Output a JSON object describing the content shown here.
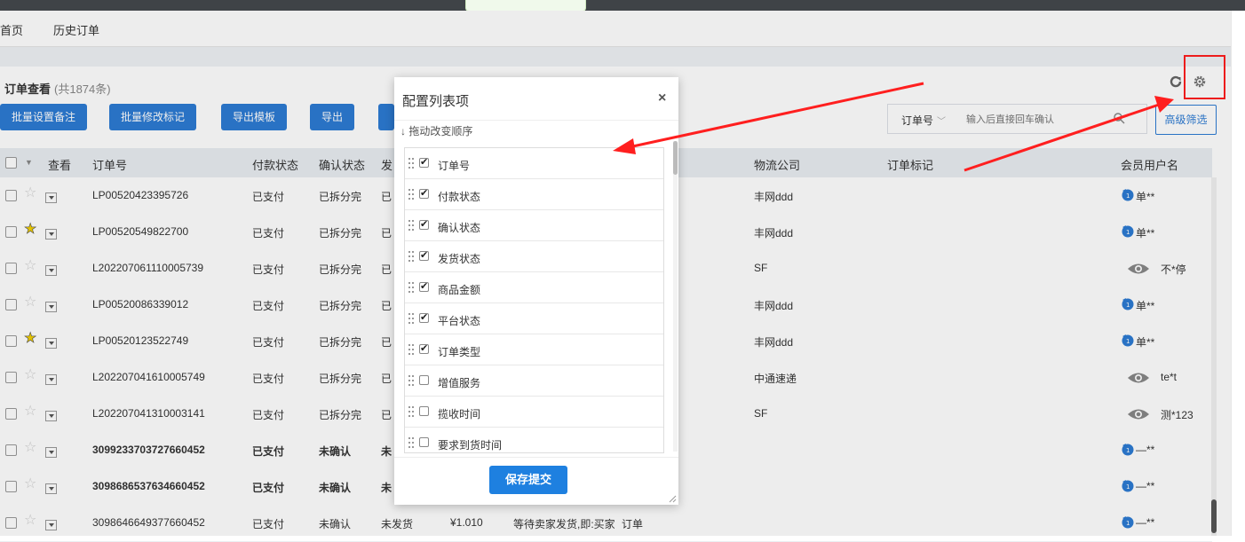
{
  "nav": {
    "tab_home": "首页",
    "tab_history": "历史订单"
  },
  "page": {
    "title": "订单查看",
    "count": "(共1874条)"
  },
  "toolbar": {
    "btn_batch_remark": "批量设置备注",
    "btn_batch_mark": "批量修改标记",
    "btn_export_template": "导出模板",
    "btn_export": "导出"
  },
  "search": {
    "field_select": "订单号",
    "placeholder": "输入后直接回车确认"
  },
  "advanced_filter": "高级筛选",
  "icons": {
    "refresh": "refresh-icon",
    "settings": "gear-icon",
    "search": "search-icon",
    "close": "close-icon",
    "eye": "eye-icon",
    "member": "member-badge-icon"
  },
  "colors": {
    "primary": "#2d7bd3",
    "highlight": "#ff1f1f",
    "star": "#f4d000"
  },
  "table": {
    "headers": {
      "view": "查看",
      "order_no": "订单号",
      "pay": "付款状态",
      "confirm": "确认状态",
      "ship": "发",
      "logistics": "物流公司",
      "mark": "订单标记",
      "member": "会员用户名"
    },
    "rows": [
      {
        "order_no": "LP00520423395726",
        "pay": "已支付",
        "confirm": "已拆分完",
        "ship": "已",
        "logistics": "丰网ddd",
        "member": "单**"
      },
      {
        "order_no": "LP00520549822700",
        "pay": "已支付",
        "confirm": "已拆分完",
        "ship": "已",
        "logistics": "丰网ddd",
        "member": "单**"
      },
      {
        "order_no": "L202207061110005739",
        "pay": "已支付",
        "confirm": "已拆分完",
        "ship": "已",
        "logistics": "SF",
        "member": "不*停"
      },
      {
        "order_no": "LP00520086339012",
        "pay": "已支付",
        "confirm": "已拆分完",
        "ship": "已",
        "logistics": "丰网ddd",
        "member": "单**"
      },
      {
        "order_no": "LP00520123522749",
        "pay": "已支付",
        "confirm": "已拆分完",
        "ship": "已",
        "logistics": "丰网ddd",
        "member": "单**"
      },
      {
        "order_no": "L202207041610005749",
        "pay": "已支付",
        "confirm": "已拆分完",
        "ship": "已",
        "logistics": "中通速递",
        "member": "te*t"
      },
      {
        "order_no": "L202207041310003141",
        "pay": "已支付",
        "confirm": "已拆分完",
        "ship": "已",
        "logistics": "SF",
        "member": "测*123"
      },
      {
        "order_no": "3099233703727660452",
        "pay": "已支付",
        "confirm": "未确认",
        "ship": "未",
        "logistics": "",
        "member": "—**"
      },
      {
        "order_no": "3098686537634660452",
        "pay": "已支付",
        "confirm": "未确认",
        "ship": "未",
        "logistics": "",
        "member": "—**"
      },
      {
        "order_no": "3098646649377660452",
        "pay": "已支付",
        "confirm": "未确认",
        "ship": "未发货",
        "amount": "¥1.010",
        "platform": "等待卖家发货,即:买家",
        "type": "订单",
        "logistics": "",
        "member": "—**"
      }
    ]
  },
  "modal": {
    "title": "配置列表项",
    "hint": "↓ 拖动改变顺序",
    "items": [
      {
        "label": "订单号",
        "checked": true
      },
      {
        "label": "付款状态",
        "checked": true
      },
      {
        "label": "确认状态",
        "checked": true
      },
      {
        "label": "发货状态",
        "checked": true
      },
      {
        "label": "商品金额",
        "checked": true
      },
      {
        "label": "平台状态",
        "checked": true
      },
      {
        "label": "订单类型",
        "checked": true
      },
      {
        "label": "增值服务",
        "checked": false
      },
      {
        "label": "揽收时间",
        "checked": false
      },
      {
        "label": "要求到货时间",
        "checked": false
      }
    ],
    "save_label": "保存提交"
  }
}
